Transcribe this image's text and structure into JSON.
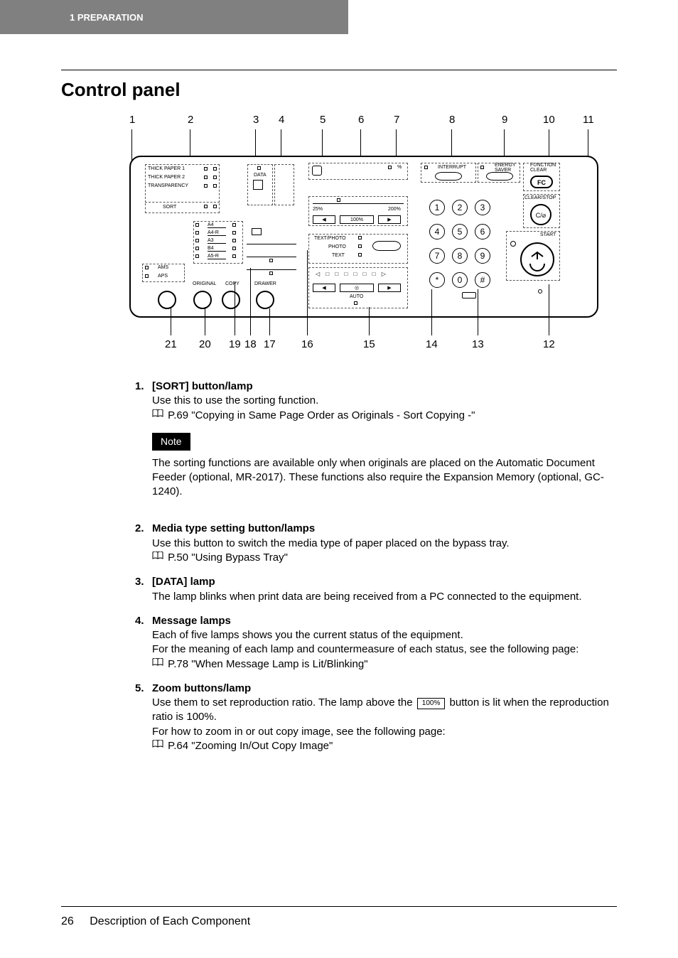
{
  "header": {
    "chapter": "1   PREPARATION"
  },
  "section": {
    "title": "Control panel"
  },
  "callouts_top": [
    "1",
    "2",
    "3",
    "4",
    "5",
    "6",
    "7",
    "8",
    "9",
    "10",
    "11"
  ],
  "callouts_bottom": [
    "21",
    "20",
    "19",
    "18",
    "17",
    "16",
    "15",
    "14",
    "13",
    "12"
  ],
  "panel": {
    "media_labels": [
      "THICK PAPER 1",
      "THICK PAPER 2",
      "TRANSPARENCY",
      "SORT"
    ],
    "paper_sizes": [
      "A4",
      "A4-R",
      "A3",
      "B4",
      "A5-R"
    ],
    "ams": "AMS",
    "aps": "APS",
    "original": "ORIGINAL",
    "copy": "COPY",
    "drawer": "DRAWER",
    "data": "DATA",
    "zoom_min": "25%",
    "zoom_max": "200%",
    "zoom_100": "100%",
    "photo_labels": [
      "TEXT/PHOTO",
      "PHOTO",
      "TEXT"
    ],
    "auto": "AUTO",
    "interrupt": "INTERRUPT",
    "energy": "ENERGY\nSAVER",
    "function_clear": "FUNCTION\nCLEAR",
    "fc": "FC",
    "clear_stop": "CLEAR/STOP",
    "co": "C/⌀",
    "start": "START",
    "keypad": [
      "1",
      "2",
      "3",
      "4",
      "5",
      "6",
      "7",
      "8",
      "9",
      "*",
      "0",
      "#"
    ]
  },
  "items": [
    {
      "num": "1.",
      "title": "[SORT] button/lamp",
      "lines": [
        "Use this to use the sorting function."
      ],
      "ref": "P.69 \"Copying in Same Page Order as Originals - Sort Copying -\"",
      "note_label": "Note",
      "note": "The sorting functions are available only when originals are placed on the Automatic Document Feeder (optional, MR-2017). These functions also require the Expansion Memory (optional, GC-1240)."
    },
    {
      "num": "2.",
      "title": "Media type setting button/lamps",
      "lines": [
        "Use this button to switch the media type of paper placed on the bypass tray."
      ],
      "ref": "P.50 \"Using Bypass Tray\""
    },
    {
      "num": "3.",
      "title": "[DATA] lamp",
      "lines": [
        "The lamp blinks when print data are being received from a PC connected to the equipment."
      ]
    },
    {
      "num": "4.",
      "title": "Message lamps",
      "lines": [
        "Each of five lamps shows you the current status of the equipment.",
        "For the meaning of each lamp and countermeasure of each status, see the following page:"
      ],
      "ref": "P.78 \"When Message Lamp is Lit/Blinking\""
    },
    {
      "num": "5.",
      "title": "Zoom buttons/lamp",
      "lines_pre": "Use them to set reproduction ratio. The lamp above the ",
      "inline": "100%",
      "lines_post": " button is lit when the reproduction ratio is 100%.",
      "lines2": "For how to zoom in or out copy image, see the following page:",
      "ref": "P.64 \"Zooming In/Out Copy Image\""
    }
  ],
  "footer": {
    "page": "26",
    "label": "Description of Each Component"
  }
}
